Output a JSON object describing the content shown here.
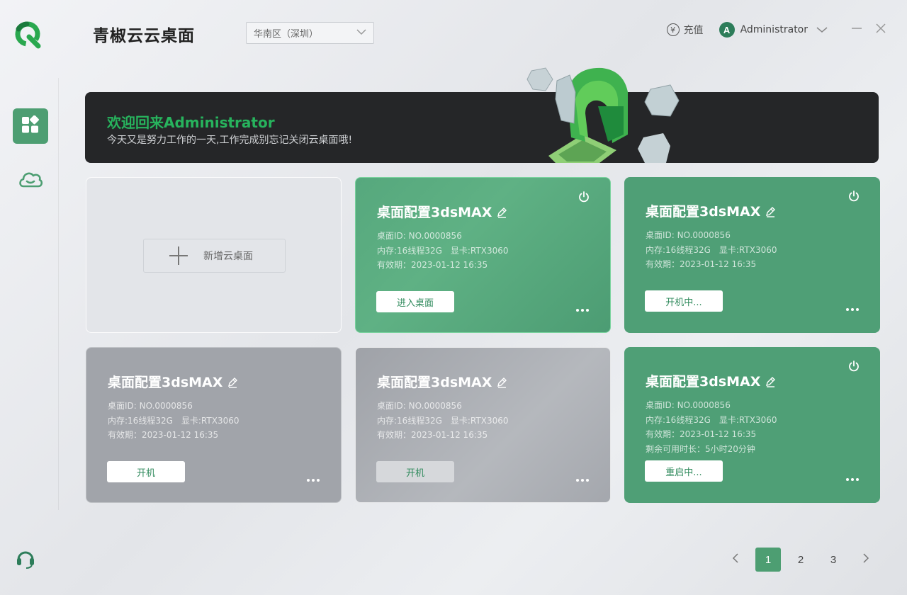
{
  "app": {
    "title": "青椒云云桌面"
  },
  "region": {
    "selected": "华南区（深圳）"
  },
  "header": {
    "recharge_label": "充值",
    "recharge_icon": "yen-icon",
    "username": "Administrator",
    "avatar_letter": "A"
  },
  "sidebar": {
    "items": [
      {
        "icon": "apps-grid-icon",
        "active": true
      },
      {
        "icon": "cloud-icon",
        "active": false
      },
      {
        "icon": "headset-icon",
        "active": false
      }
    ]
  },
  "banner": {
    "title": "欢迎回来Administrator",
    "subtitle": "今天又是努力工作的一天,工作完成别忘记关闭云桌面哦!"
  },
  "add_card": {
    "label": "新增云桌面"
  },
  "desktops": [
    {
      "name": "桌面配置3dsMAX",
      "id_line": "桌面ID: NO.0000856",
      "memory": "内存:16线程32G",
      "gpu": "显卡:RTX3060",
      "expiry": "有效期：2023-01-12 16:35",
      "button": "进入桌面",
      "state": "running"
    },
    {
      "name": "桌面配置3dsMAX",
      "id_line": "桌面ID: NO.0000856",
      "memory": "内存:16线程32G",
      "gpu": "显卡:RTX3060",
      "expiry": "有效期：2023-01-12 16:35",
      "button": "开机中...",
      "state": "starting"
    },
    {
      "name": "桌面配置3dsMAX",
      "id_line": "桌面ID: NO.0000856",
      "memory": "内存:16线程32G",
      "gpu": "显卡:RTX3060",
      "expiry": "有效期：2023-01-12 16:35",
      "button": "开机",
      "state": "off"
    },
    {
      "name": "桌面配置3dsMAX",
      "id_line": "桌面ID: NO.0000856",
      "memory": "内存:16线程32G",
      "gpu": "显卡:RTX3060",
      "expiry": "有效期：2023-01-12 16:35",
      "button": "开机",
      "state": "off-disabled"
    },
    {
      "name": "桌面配置3dsMAX",
      "id_line": "桌面ID: NO.0000856",
      "memory": "内存:16线程32G",
      "gpu": "显卡:RTX3060",
      "expiry": "有效期：2023-01-12 16:35",
      "remaining": "剩余可用时长：5小时20分钟",
      "button": "重启中...",
      "state": "restarting"
    }
  ],
  "pagination": {
    "pages": [
      "1",
      "2",
      "3"
    ],
    "current": "1"
  },
  "colors": {
    "brand": "#4d9e72",
    "card_green": "#4f9f76",
    "card_gray": "#a1a4aa",
    "banner_bg": "#252628",
    "banner_title": "#27b35d"
  }
}
